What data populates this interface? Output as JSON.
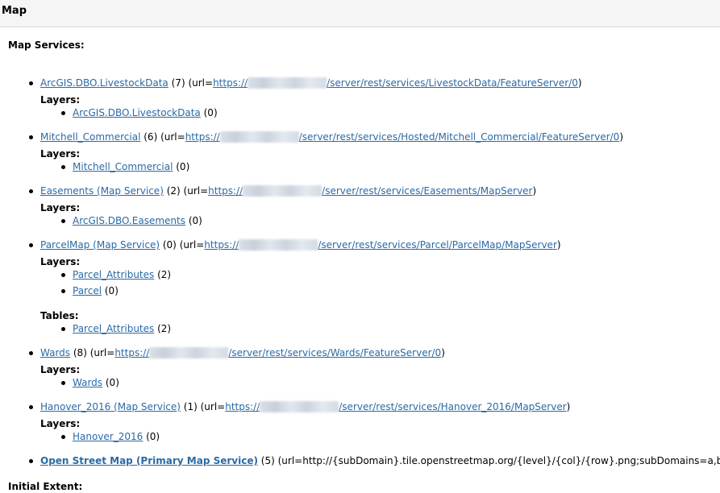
{
  "header": {
    "title": "Map"
  },
  "section": {
    "title": "Map Services:"
  },
  "labels": {
    "layers": "Layers:",
    "tables": "Tables:"
  },
  "url_prefix": "(url=",
  "url_suffix": ")",
  "services": [
    {
      "name": "ArcGIS.DBO.LivestockData",
      "count": "(7)",
      "url_scheme": "https://",
      "url_path": "/server/rest/services/LivestockData/FeatureServer/0",
      "layers": [
        {
          "name": "ArcGIS.DBO.LivestockData",
          "count": "(0)"
        }
      ]
    },
    {
      "name": "Mitchell_Commercial",
      "count": "(6)",
      "url_scheme": "https://",
      "url_path": "/server/rest/services/Hosted/Mitchell_Commercial/FeatureServer/0",
      "layers": [
        {
          "name": "Mitchell_Commercial",
          "count": "(0)"
        }
      ]
    },
    {
      "name": "Easements (Map Service)",
      "count": "(2)",
      "url_scheme": "https://",
      "url_path": "/server/rest/services/Easements/MapServer",
      "layers": [
        {
          "name": "ArcGIS.DBO.Easements",
          "count": "(0)"
        }
      ]
    },
    {
      "name": "ParcelMap (Map Service)",
      "count": "(0)",
      "url_scheme": "https://",
      "url_path": "/server/rest/services/Parcel/ParcelMap/MapServer",
      "layers": [
        {
          "name": "Parcel_Attributes",
          "count": "(2)"
        },
        {
          "name": "Parcel",
          "count": "(0)"
        }
      ],
      "tables": [
        {
          "name": "Parcel_Attributes",
          "count": "(2)"
        }
      ]
    },
    {
      "name": "Wards",
      "count": "(8)",
      "url_scheme": "https://",
      "url_path": "/server/rest/services/Wards/FeatureServer/0",
      "layers": [
        {
          "name": "Wards",
          "count": "(0)"
        }
      ]
    },
    {
      "name": "Hanover_2016 (Map Service)",
      "count": "(1)",
      "url_scheme": "https://",
      "url_path": "/server/rest/services/Hanover_2016/MapServer",
      "layers": [
        {
          "name": "Hanover_2016",
          "count": "(0)"
        }
      ]
    },
    {
      "name": "Open Street Map (Primary Map Service)",
      "count": "(5)",
      "url_text": "(url=http://{subDomain}.tile.openstreetmap.org/{level}/{col}/{row}.png;subDomains=a,b,c)"
    }
  ],
  "next_section": {
    "title": "Initial Extent:"
  },
  "colors": {
    "link": "#2a6aa6",
    "header_bg": "#f5f5f5"
  }
}
